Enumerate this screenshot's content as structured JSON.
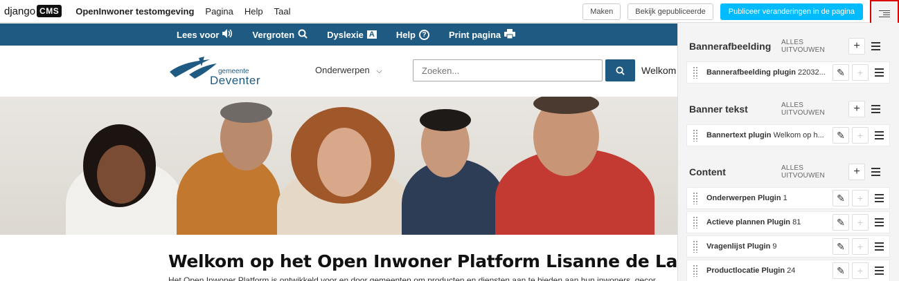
{
  "cms_toolbar": {
    "logo_text": "django",
    "logo_badge": "CMS",
    "menu": [
      {
        "label": "OpenInwoner testomgeving"
      },
      {
        "label": "Pagina"
      },
      {
        "label": "Help"
      },
      {
        "label": "Taal"
      }
    ],
    "buttons": {
      "create": "Maken",
      "view_published": "Bekijk gepubliceerde",
      "publish": "Publiceer veranderingen in de pagina"
    },
    "structure_toggle_icon": "structure-icon",
    "accent_color": "#00bbff"
  },
  "accessibility_bar": {
    "items": [
      {
        "label": "Lees voor",
        "icon": "speaker-icon"
      },
      {
        "label": "Vergroten",
        "icon": "zoom-icon"
      },
      {
        "label": "Dyslexie",
        "icon": "dyslexia-icon"
      },
      {
        "label": "Help",
        "icon": "help-icon"
      },
      {
        "label": "Print pagina",
        "icon": "printer-icon"
      }
    ],
    "color": "#1e5a82"
  },
  "header": {
    "logo_small": "gemeente",
    "logo_big": "Deventer",
    "nav_topics": "Onderwerpen",
    "search_placeholder": "Zoeken...",
    "welcome_short": "Welkom l"
  },
  "content": {
    "title": "Welkom op het Open Inwoner Platform Lisanne de Landgraaf",
    "intro": "Het Open Inwoner Platform is ontwikkeld voor en door gemeenten om producten en diensten aan te bieden aan hun inwoners, gecor"
  },
  "sidebar": {
    "expand_all_label": "ALLES UITVOUWEN",
    "placeholders": [
      {
        "title": "Bannerafbeelding",
        "plugins": [
          {
            "name": "Bannerafbeelding plugin",
            "detail": "22032..."
          }
        ]
      },
      {
        "title": "Banner tekst",
        "plugins": [
          {
            "name": "Bannertext plugin",
            "detail": "Welkom op h..."
          }
        ]
      },
      {
        "title": "Content",
        "plugins": [
          {
            "name": "Onderwerpen Plugin",
            "detail": "1"
          },
          {
            "name": "Actieve plannen Plugin",
            "detail": "81"
          },
          {
            "name": "Vragenlijst Plugin",
            "detail": "9"
          },
          {
            "name": "Productlocatie Plugin",
            "detail": "24"
          }
        ]
      }
    ]
  }
}
